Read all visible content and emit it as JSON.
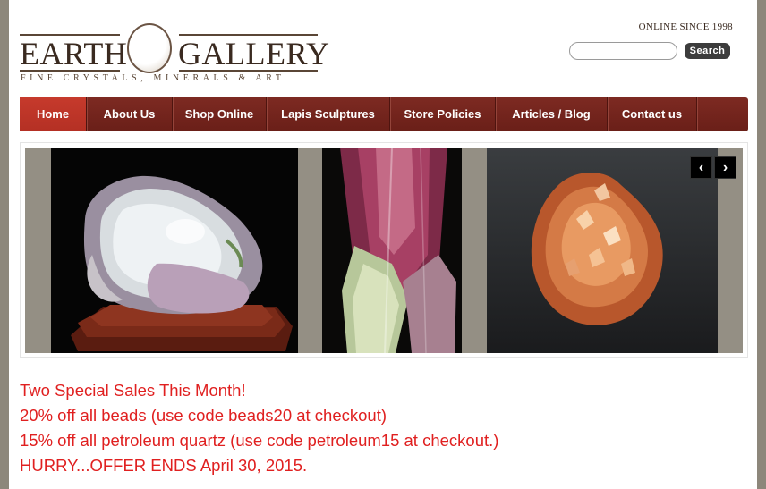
{
  "header": {
    "online_since": "ONLINE SINCE 1998",
    "logo": {
      "word_left": "EARTH",
      "word_right": "GALLERY",
      "tagline": "FINE CRYSTALS, MINERALS & ART"
    },
    "search": {
      "placeholder": "",
      "button_label": "Search"
    }
  },
  "nav": {
    "items": [
      {
        "label": "Home",
        "active": true
      },
      {
        "label": "About Us"
      },
      {
        "label": "Shop Online"
      },
      {
        "label": "Lapis Sculptures"
      },
      {
        "label": "Store Policies"
      },
      {
        "label": "Articles / Blog"
      },
      {
        "label": "Contact us"
      }
    ]
  },
  "slider": {
    "prev_icon": "chevron-left-icon",
    "next_icon": "chevron-right-icon",
    "prev_glyph": "‹",
    "next_glyph": "›"
  },
  "promo": {
    "line1": "Two Special Sales This Month!",
    "line2": "20% off all beads (use code beads20 at checkout)",
    "line3": "15% off all petroleum quartz (use code petroleum15 at checkout.)",
    "line4": "HURRY...OFFER ENDS April 30, 2015."
  },
  "colors": {
    "nav_bg": "#6f231b",
    "nav_active": "#c0372a",
    "promo_text": "#e02020",
    "brand_brown": "#3a2a20"
  }
}
